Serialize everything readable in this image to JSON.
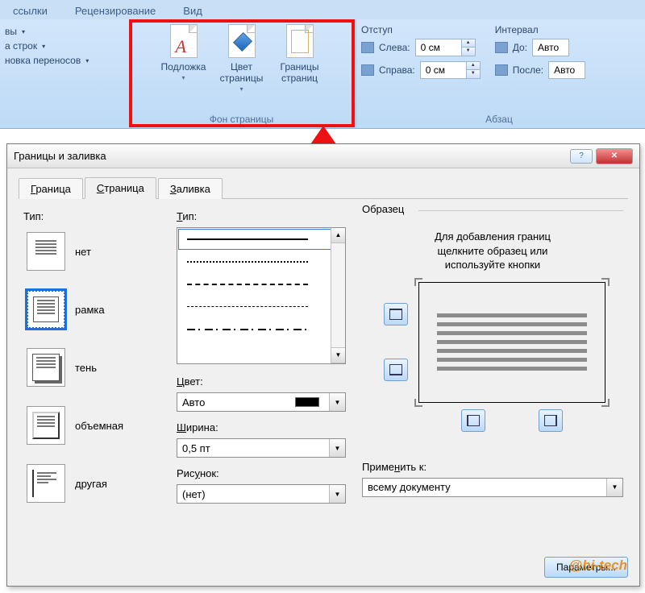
{
  "ribbon": {
    "tabs": [
      "ссылки",
      "Рецензирование",
      "Вид"
    ],
    "left_group": {
      "line1": "вы",
      "line2": "а строк",
      "line3": "новка переносов"
    },
    "page_bg": {
      "label": "Фон страницы",
      "watermark": "Подложка",
      "page_color": "Цвет\nстраницы",
      "page_borders": "Границы\nстраниц"
    },
    "paragraph": {
      "label": "Абзац",
      "indent_label": "Отступ",
      "left": "Слева:",
      "right": "Справа:",
      "left_val": "0 см",
      "right_val": "0 см",
      "interval_label": "Интервал",
      "before": "До:",
      "after": "После:",
      "before_val": "Авто",
      "after_val": "Авто"
    }
  },
  "dialog": {
    "title": "Границы и заливка",
    "tabs": {
      "border": "Граница",
      "page": "Страница",
      "fill": "Заливка"
    },
    "type_label": "Тип:",
    "types": {
      "none": "нет",
      "box": "рамка",
      "shadow": "тень",
      "threeD": "объемная",
      "custom": "другая"
    },
    "style_label": "Тип:",
    "color_label": "Цвет:",
    "color_val": "Авто",
    "width_label": "Ширина:",
    "width_val": "0,5 пт",
    "art_label": "Рисунок:",
    "art_val": "(нет)",
    "sample_label": "Образец",
    "hint": "Для добавления границ\nщелкните образец или\nиспользуйте кнопки",
    "apply_label": "Применить к:",
    "apply_val": "всему документу",
    "options_btn": "Параметры..."
  },
  "watermark": "@hi-tech"
}
